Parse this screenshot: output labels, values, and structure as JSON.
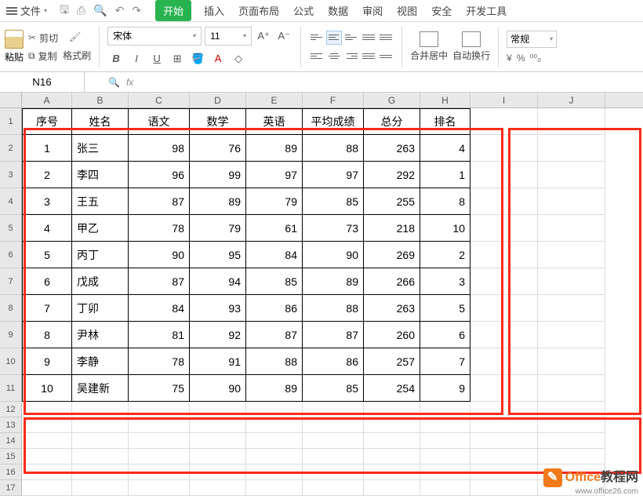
{
  "menubar": {
    "file": "文件",
    "tabs": [
      "开始",
      "插入",
      "页面布局",
      "公式",
      "数据",
      "审阅",
      "视图",
      "安全",
      "开发工具"
    ],
    "active_tab": 0
  },
  "ribbon": {
    "paste": "粘贴",
    "cut": "剪切",
    "copy": "复制",
    "format_painter": "格式刷",
    "font_name": "宋体",
    "font_size": "11",
    "merge_center": "合并居中",
    "wrap_text": "自动换行",
    "num_format": "常规"
  },
  "namebox": "N16",
  "columns": [
    "A",
    "B",
    "C",
    "D",
    "E",
    "F",
    "G",
    "H",
    "I",
    "J"
  ],
  "table": {
    "headers": [
      "序号",
      "姓名",
      "语文",
      "数学",
      "英语",
      "平均成绩",
      "总分",
      "排名"
    ],
    "rows": [
      {
        "n": "1",
        "name": "张三",
        "c": "98",
        "d": "76",
        "e": "89",
        "f": "88",
        "g": "263",
        "h": "4"
      },
      {
        "n": "2",
        "name": "李四",
        "c": "96",
        "d": "99",
        "e": "97",
        "f": "97",
        "g": "292",
        "h": "1"
      },
      {
        "n": "3",
        "name": "王五",
        "c": "87",
        "d": "89",
        "e": "79",
        "f": "85",
        "g": "255",
        "h": "8"
      },
      {
        "n": "4",
        "name": "甲乙",
        "c": "78",
        "d": "79",
        "e": "61",
        "f": "73",
        "g": "218",
        "h": "10"
      },
      {
        "n": "5",
        "name": "丙丁",
        "c": "90",
        "d": "95",
        "e": "84",
        "f": "90",
        "g": "269",
        "h": "2"
      },
      {
        "n": "6",
        "name": "戊成",
        "c": "87",
        "d": "94",
        "e": "85",
        "f": "89",
        "g": "266",
        "h": "3"
      },
      {
        "n": "7",
        "name": "丁卯",
        "c": "84",
        "d": "93",
        "e": "86",
        "f": "88",
        "g": "263",
        "h": "5"
      },
      {
        "n": "8",
        "name": "尹林",
        "c": "81",
        "d": "92",
        "e": "87",
        "f": "87",
        "g": "260",
        "h": "6"
      },
      {
        "n": "9",
        "name": "李静",
        "c": "78",
        "d": "91",
        "e": "88",
        "f": "86",
        "g": "257",
        "h": "7"
      },
      {
        "n": "10",
        "name": "吴建新",
        "c": "75",
        "d": "90",
        "e": "89",
        "f": "85",
        "g": "254",
        "h": "9"
      }
    ]
  },
  "watermark": {
    "brand": "Office",
    "suffix": "教程网",
    "url": "www.office26.com"
  }
}
